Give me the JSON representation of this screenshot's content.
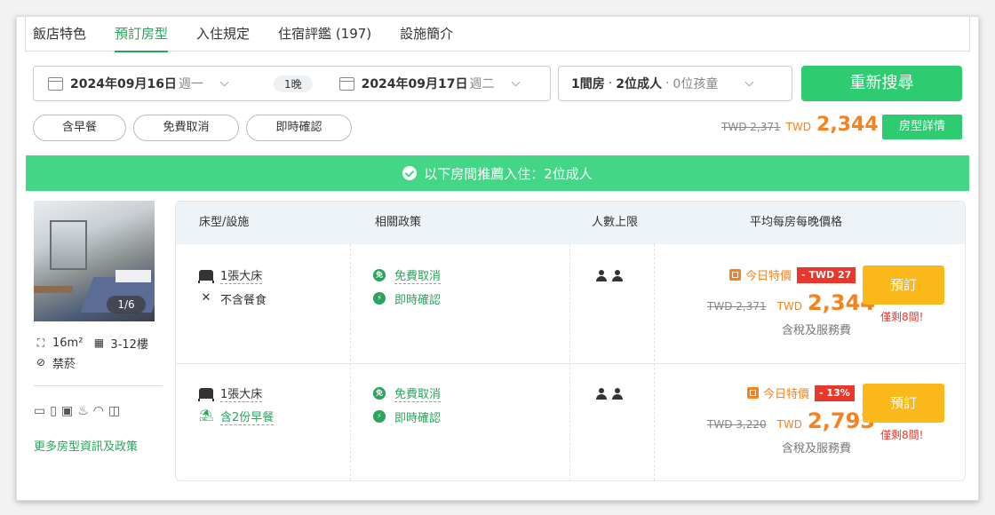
{
  "tabs": [
    "飯店特色",
    "預訂房型",
    "入住規定",
    "住宿評鑑 (197)",
    "設施簡介"
  ],
  "active_tab": "預訂房型",
  "search": {
    "checkin_date": "2024年09月16日",
    "checkin_weekday": "週一",
    "nights": "1晚",
    "checkout_date": "2024年09月17日",
    "checkout_weekday": "週二",
    "rooms": "1間房",
    "adults": "2位成人",
    "children": "0位孩童",
    "search_button": "重新搜尋"
  },
  "filters": [
    "含早餐",
    "免費取消",
    "即時確認"
  ],
  "summary": {
    "old_price": "TWD 2,371",
    "currency": "TWD",
    "price": "2,344",
    "detail_button": "房型詳情"
  },
  "banner": "以下房間推薦入住：2位成人",
  "room": {
    "photo_count": "1/6",
    "size": "16m²",
    "floors": "3-12樓",
    "smoking": "禁菸",
    "more_link": "更多房型資訊及政策"
  },
  "table": {
    "headers": [
      "床型/設施",
      "相關政策",
      "人數上限",
      "平均每房每晚價格"
    ],
    "rows": [
      {
        "bed": "1張大床",
        "meal": "不含餐食",
        "policy1": "免費取消",
        "policy2": "即時確認",
        "deal_label": "今日特價",
        "discount": "- TWD 27",
        "old_price": "TWD 2,371",
        "currency": "TWD",
        "price": "2,344",
        "tax_note": "含稅及服務費",
        "book": "預訂",
        "left": "僅剩8間!"
      },
      {
        "bed": "1張大床",
        "meal": "含2份早餐",
        "policy1": "免費取消",
        "policy2": "即時確認",
        "deal_label": "今日特價",
        "discount": "- 13%",
        "old_price": "TWD 3,220",
        "currency": "TWD",
        "price": "2,793",
        "tax_note": "含稅及服務費",
        "book": "預訂",
        "left": "僅剩8間!"
      }
    ]
  },
  "colors": {
    "green": "#2ecc71",
    "orange": "#f5821f",
    "red": "#e8382c",
    "yellow": "#fbb81b"
  }
}
